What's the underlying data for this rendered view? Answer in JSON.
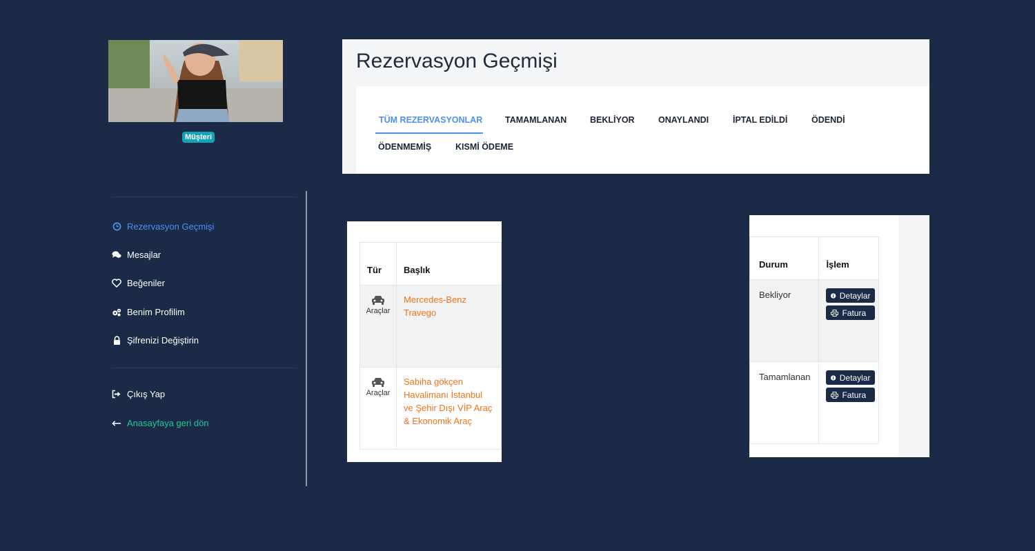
{
  "profile": {
    "badge": "Müşteri"
  },
  "sidebar": {
    "items": [
      {
        "label": "Rezervasyon Geçmişi",
        "icon": "clock-icon"
      },
      {
        "label": "Mesajlar",
        "icon": "comments-icon"
      },
      {
        "label": "Beğeniler",
        "icon": "heart-icon"
      },
      {
        "label": "Benim Profilim",
        "icon": "cogs-icon"
      },
      {
        "label": "Şifrenizi Değiştirin",
        "icon": "lock-icon"
      }
    ],
    "logout": {
      "label": "Çıkış Yap",
      "icon": "sign-out-icon"
    },
    "home": {
      "label": "Anasayfaya geri dön",
      "icon": "arrow-left-icon"
    }
  },
  "header": {
    "title": "Rezervasyon Geçmişi",
    "tabs": [
      "TÜM REZERVASYONLAR",
      "TAMAMLANAN",
      "BEKLİYOR",
      "ONAYLANDI",
      "İPTAL EDİLDİ",
      "ÖDENDİ",
      "ÖDENMEMİŞ",
      "KISMİ ÖDEME"
    ]
  },
  "reservations_table": {
    "headers": {
      "type": "Tür",
      "title": "Başlık"
    },
    "rows": [
      {
        "type": "Araçlar",
        "title": "Mercedes-Benz Travego"
      },
      {
        "type": "Araçlar",
        "title": "Sabiha gökçen Havalimanı İstanbul ve Şehir Dışı VİP Araç & Ekonomik Araç"
      }
    ]
  },
  "status_table": {
    "headers": {
      "status": "Durum",
      "action": "İşlem"
    },
    "rows": [
      {
        "status": "Bekliyor",
        "details": "Detaylar",
        "invoice": "Fatura"
      },
      {
        "status": "Tamamlanan",
        "details": "Detaylar",
        "invoice": "Fatura"
      }
    ]
  },
  "colors": {
    "background": "#1b2a47",
    "accent_blue": "#4f8ff0",
    "link_orange": "#f0731c",
    "badge_teal": "#17a2b8",
    "home_green": "#20c997"
  }
}
